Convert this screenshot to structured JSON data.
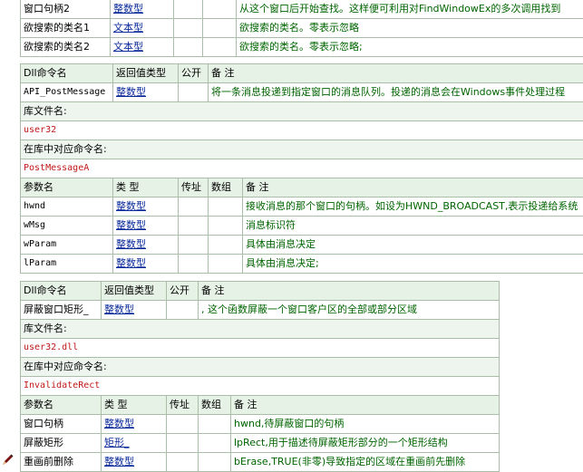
{
  "t1": {
    "rows": [
      {
        "name": "窗口句柄2",
        "type": "整数型",
        "remark": "从这个窗口后开始查找。这样便可利用对FindWindowEx的多次调用找到"
      },
      {
        "name": "欲搜索的类名1",
        "type": "文本型",
        "remark": "欲搜索的类名。零表示忽略"
      },
      {
        "name": "欲搜索的类名2",
        "type": "文本型",
        "remark": "欲搜索的类名。零表示忽略;"
      }
    ]
  },
  "t2": {
    "headers": {
      "dll_cmd": "Dll命令名",
      "ret_type": "返回值类型",
      "public": "公开",
      "remark": "备 注"
    },
    "cmd": {
      "name": "API_PostMessage",
      "type": "整数型",
      "public": "",
      "remark": "将一条消息投递到指定窗口的消息队列。投递的消息会在Windows事件处理过程"
    },
    "lib_label": "库文件名:",
    "lib": "user32",
    "entry_label": "在库中对应命令名:",
    "entry": "PostMessageA",
    "param_headers": {
      "name": "参数名",
      "type": "类 型",
      "byref": "传址",
      "array": "数组",
      "remark": "备 注"
    },
    "params": [
      {
        "name": "hwnd",
        "type": "整数型",
        "remark": "接收消息的那个窗口的句柄。如设为HWND_BROADCAST,表示投递给系统"
      },
      {
        "name": "wMsg",
        "type": "整数型",
        "remark": "消息标识符"
      },
      {
        "name": "wParam",
        "type": "整数型",
        "remark": "具体由消息决定"
      },
      {
        "name": "lParam",
        "type": "整数型",
        "remark": "具体由消息决定;"
      }
    ]
  },
  "t3": {
    "headers": {
      "dll_cmd": "Dll命令名",
      "ret_type": "返回值类型",
      "public": "公开",
      "remark": "备 注"
    },
    "cmd": {
      "name": "屏蔽窗口矩形_",
      "type": "整数型",
      "public": "",
      "remark": ", 这个函数屏蔽一个窗口客户区的全部或部分区域"
    },
    "lib_label": "库文件名:",
    "lib": "user32.dll",
    "entry_label": "在库中对应命令名:",
    "entry": "InvalidateRect",
    "param_headers": {
      "name": "参数名",
      "type": "类 型",
      "byref": "传址",
      "array": "数组",
      "remark": "备 注"
    },
    "params": [
      {
        "name": "窗口句柄",
        "type": "整数型",
        "remark": "hwnd,待屏蔽窗口的句柄"
      },
      {
        "name": "屏蔽矩形",
        "type": "矩形_",
        "remark": "lpRect,用于描述待屏蔽矩形部分的一个矩形结构"
      },
      {
        "name": "重画前删除",
        "type": "整数型",
        "remark": "bErase,TRUE(非零)导致指定的区域在重画前先删除"
      }
    ]
  },
  "colors": {
    "border": "#a9bda9",
    "header_bg": "#e7f2e7",
    "code": "#c01818",
    "type_link": "#0a2a9a",
    "remark": "#006400"
  },
  "icons": {
    "pen": "pencil-icon"
  }
}
